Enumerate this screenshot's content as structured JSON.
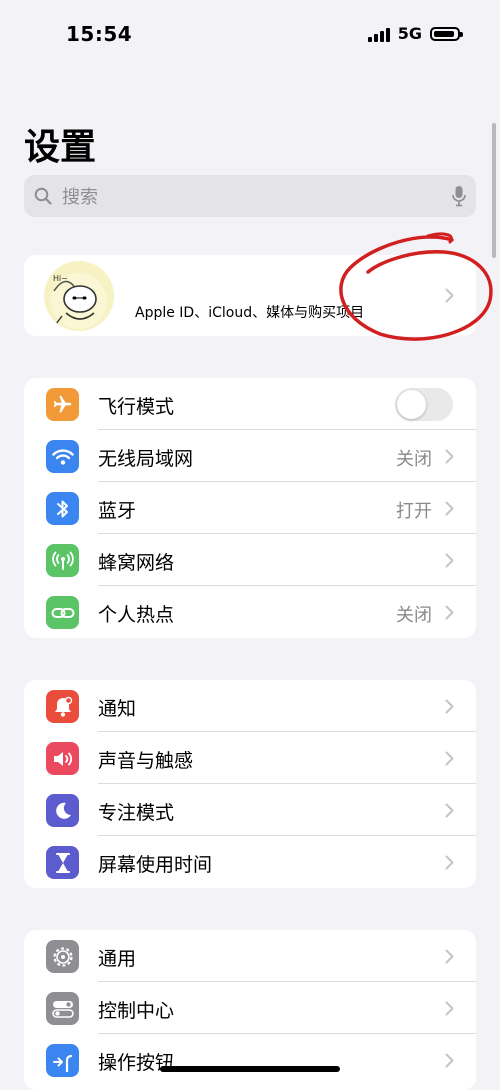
{
  "status_bar": {
    "time": "15:54",
    "network": "5G"
  },
  "header": {
    "title": "设置"
  },
  "search": {
    "placeholder": "搜索"
  },
  "profile": {
    "label": "Apple ID、iCloud、媒体与购买项目",
    "avatar_text": "Hi~"
  },
  "sections": [
    {
      "items": [
        {
          "label": "飞行模式",
          "icon": "airplane-icon",
          "color": "#f19a37",
          "toggle": false
        },
        {
          "label": "无线局域网",
          "icon": "wifi-icon",
          "color": "#3a85f0",
          "value": "关闭"
        },
        {
          "label": "蓝牙",
          "icon": "bluetooth-icon",
          "color": "#3a85f0",
          "value": "打开"
        },
        {
          "label": "蜂窝网络",
          "icon": "cellular-icon",
          "color": "#5ac466",
          "value": ""
        },
        {
          "label": "个人热点",
          "icon": "hotspot-icon",
          "color": "#5ac466",
          "value": "关闭"
        }
      ]
    },
    {
      "items": [
        {
          "label": "通知",
          "icon": "bell-icon",
          "color": "#eb4d3d"
        },
        {
          "label": "声音与触感",
          "icon": "speaker-icon",
          "color": "#eb4a5e"
        },
        {
          "label": "专注模式",
          "icon": "moon-icon",
          "color": "#5d5ccf"
        },
        {
          "label": "屏幕使用时间",
          "icon": "hourglass-icon",
          "color": "#5d5ccf"
        }
      ]
    },
    {
      "items": [
        {
          "label": "通用",
          "icon": "gear-icon",
          "color": "#8e8e93"
        },
        {
          "label": "控制中心",
          "icon": "switches-icon",
          "color": "#8e8e93"
        },
        {
          "label": "操作按钮",
          "icon": "action-button-icon",
          "color": "#3a85f0"
        }
      ]
    }
  ]
}
